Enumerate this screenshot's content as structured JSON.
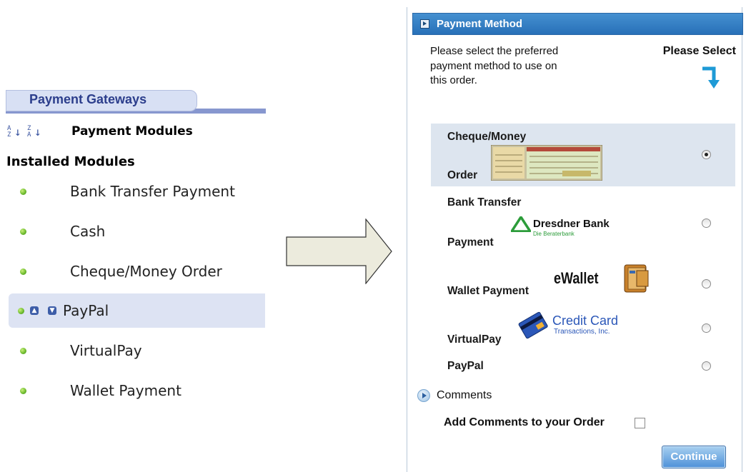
{
  "left": {
    "tab_label": "Payment Gateways",
    "sort_title": "Payment Modules",
    "installed_heading": "Installed Modules",
    "modules": [
      {
        "label": "Bank Transfer Payment"
      },
      {
        "label": "Cash"
      },
      {
        "label": "Cheque/Money Order"
      },
      {
        "label": "PayPal",
        "selected": true
      },
      {
        "label": "VirtualPay"
      },
      {
        "label": "Wallet Payment"
      }
    ]
  },
  "right": {
    "header_title": "Payment Method",
    "instructions": "Please select the preferred payment method to use on this order.",
    "please_select": "Please Select",
    "options": [
      {
        "line1": "Cheque/Money",
        "line2": "Order",
        "checked": true,
        "image": "cheque-image"
      },
      {
        "line1": "Bank Transfer",
        "line2": "Payment",
        "checked": false,
        "image": "dresdner-bank-logo",
        "logo_text": "Dresdner Bank",
        "logo_sub": "Die Beraterbank"
      },
      {
        "line1": "Wallet Payment",
        "checked": false,
        "image": "ewallet-logo",
        "logo_text": "eWallet"
      },
      {
        "line1": "VirtualPay",
        "checked": false,
        "image": "credit-card-logo",
        "logo_text1": "Credit Card",
        "logo_text2": "Transactions, Inc."
      },
      {
        "line1": "PayPal",
        "checked": false
      }
    ],
    "comments_label": "Comments",
    "add_comments_label": "Add Comments to your Order",
    "continue_label": "Continue"
  },
  "colors": {
    "header_blue": "#2f7cc4",
    "selected_row": "#dde5ef",
    "tab_strip": "#8797cf",
    "arrow_blue": "#1e9ad6"
  }
}
